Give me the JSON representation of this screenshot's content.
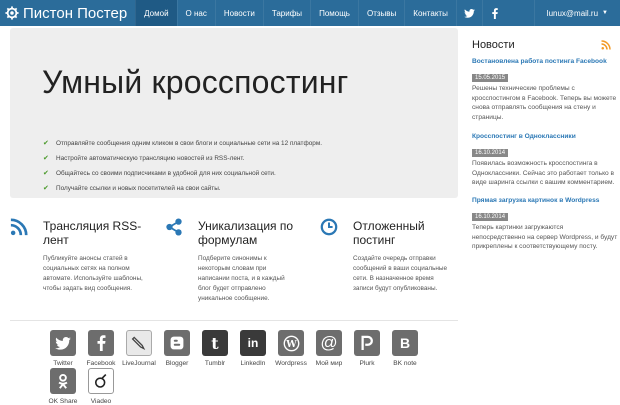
{
  "nav": {
    "brand": "Пистон Постер",
    "items": [
      "Домой",
      "О нас",
      "Новости",
      "Тарифы",
      "Помощь",
      "Отзывы",
      "Контакты"
    ],
    "user": "lunux@mail.ru"
  },
  "hero": {
    "title": "Умный кросспостинг",
    "bullets": [
      "Отправляйте сообщения одним кликом в свои блоги и социальные сети на 12 платформ.",
      "Настройте автоматическую трансляцию новостей из RSS-лент.",
      "Общайтесь со своими подписчиками в удобной для них социальной сети.",
      "Получайте ссылки и новых посетителей на свои сайты."
    ]
  },
  "features": [
    {
      "icon": "rss-icon",
      "title": "Трансляция RSS-лент",
      "text": "Публикуйте анонсы статей в социальных сетях на полном автомате. Используйте шаблоны, чтобы задать вид сообщения."
    },
    {
      "icon": "share-icon",
      "title": "Уникализация по формулам",
      "text": "Подберите синонимы к некоторым словам при написании поста, и в каждый блог будет отправлено уникальное сообщение."
    },
    {
      "icon": "clock-icon",
      "title": "Отложенный постинг",
      "text": "Создайте очередь отправки сообщений в ваши социальные сети. В назначенное время записи будут опубликованы."
    }
  ],
  "services": [
    "Twitter",
    "Facebook",
    "LiveJournal",
    "Blogger",
    "Tumblr",
    "LinkedIn",
    "Wordpress",
    "Мой мир",
    "Plurk",
    "BK note",
    "OK Share",
    "Viadeo"
  ],
  "sidebar": {
    "title": "Новости",
    "news": [
      {
        "title": "Востановлена работа постинга Facebook",
        "date": "15.05.2015",
        "text": "Решены технические проблемы с кросспостингом в Facebook. Теперь вы можете снова отправлять сообщения на стену и страницы."
      },
      {
        "title": "Кросспостинг в Одноклассники",
        "date": "16.10.2014",
        "text": "Появилась возможность кросспостинга в Одноклассники. Сейчас это работает только в виде шаринга ссылки с вашим комментарием."
      },
      {
        "title": "Прямая загрузка картинок в Wordpress",
        "date": "16.10.2014",
        "text": "Теперь картинки загружаются непосредственно на сервер Wordpress, и будут прикреплены к соответствующему посту."
      }
    ]
  },
  "colors": {
    "navbar": "#2b6c9a",
    "accent": "#2b78b5",
    "rss": "#f39a25",
    "check": "#4a9a2b"
  }
}
